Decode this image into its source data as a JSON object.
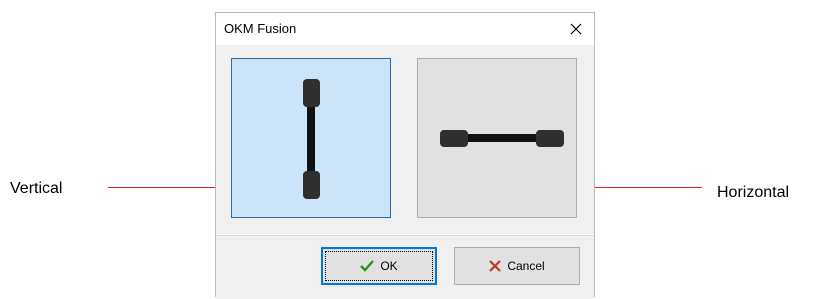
{
  "dialog": {
    "title": "OKM Fusion",
    "options": [
      {
        "id": "vertical",
        "selected": true
      },
      {
        "id": "horizontal",
        "selected": false
      }
    ],
    "ok_label": "OK",
    "cancel_label": "Cancel"
  },
  "annotations": {
    "left_label": "Vertical",
    "right_label": "Horizontal"
  },
  "icons": {
    "close": "close-icon",
    "ok": "checkmark-icon",
    "cancel": "x-icon"
  },
  "colors": {
    "selected_bg": "#cce4f7",
    "selected_border": "#2b6ea6",
    "annotation_line": "#e02020",
    "ok_check": "#2f8f1f",
    "cancel_x": "#c0392b"
  }
}
